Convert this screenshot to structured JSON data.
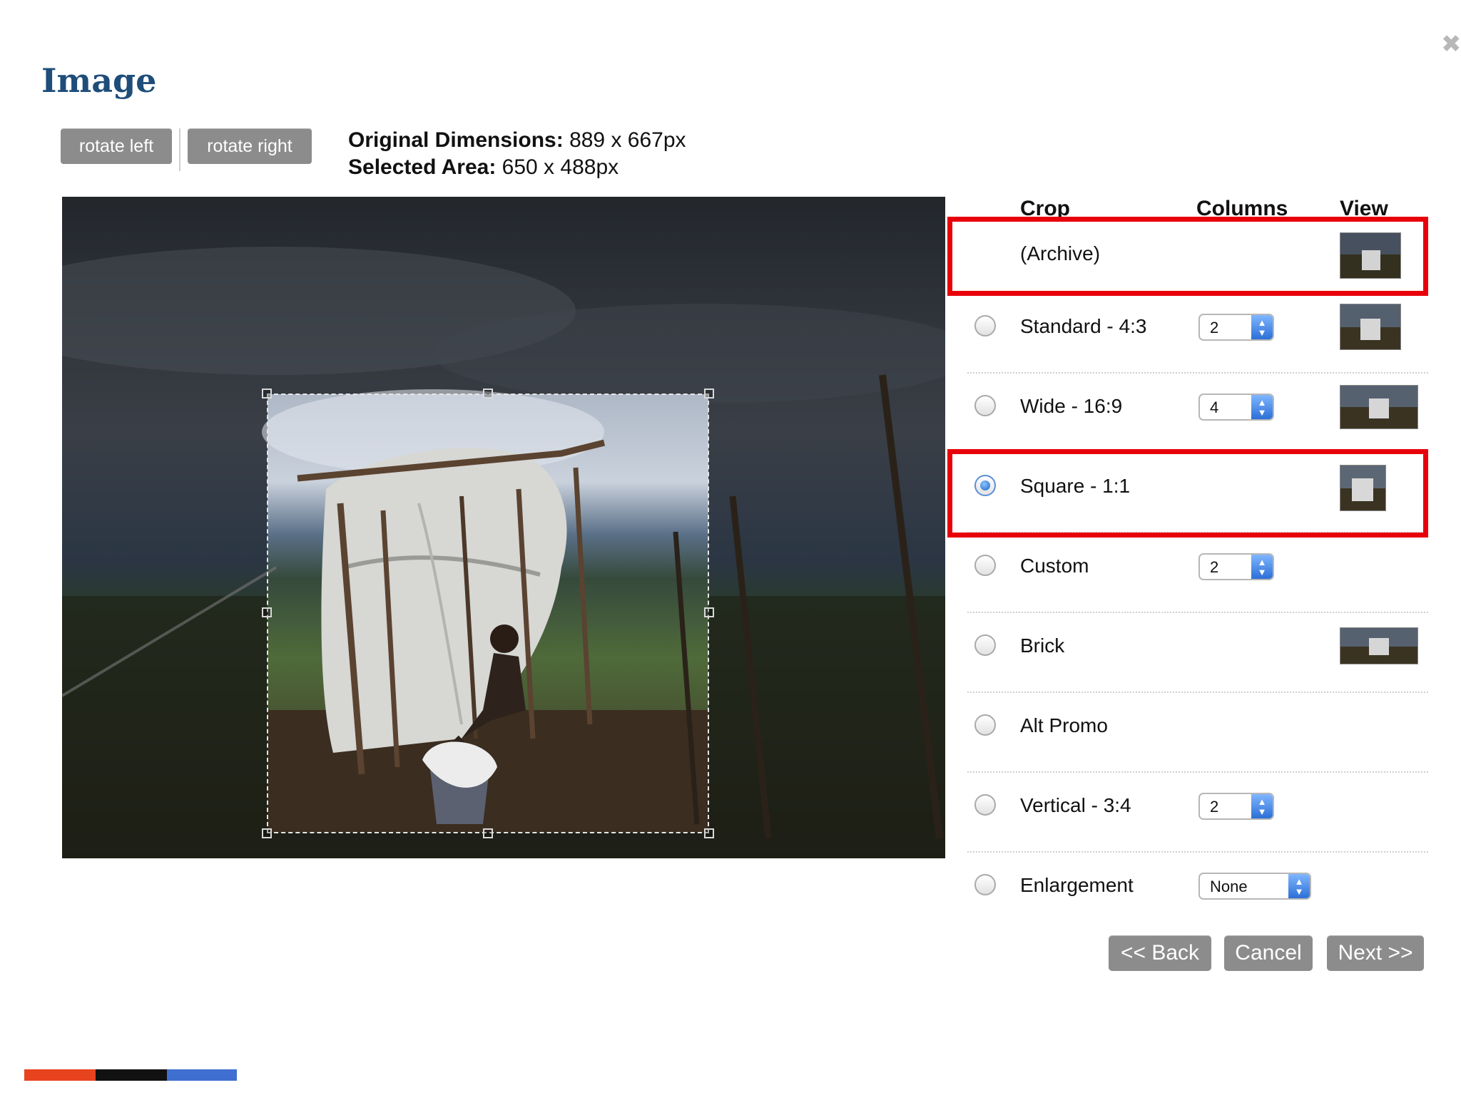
{
  "dialog": {
    "title": "Image",
    "close_symbol": "✖"
  },
  "toolbar": {
    "rotate_left": "rotate left",
    "rotate_right": "rotate right"
  },
  "dimensions": {
    "original_label": "Original Dimensions:",
    "original_value": "889 x 667px",
    "selected_label": "Selected Area:",
    "selected_value": "650 x 488px"
  },
  "table": {
    "headers": {
      "crop": "Crop",
      "columns": "Columns",
      "view": "View"
    }
  },
  "crop_options": [
    {
      "label": "(Archive)",
      "has_radio": false,
      "columns": null,
      "has_thumb": true,
      "highlighted": true
    },
    {
      "label": "Standard - 4:3",
      "has_radio": true,
      "selected": false,
      "columns": "2",
      "has_thumb": true
    },
    {
      "label": "Wide - 16:9",
      "has_radio": true,
      "selected": false,
      "columns": "4",
      "has_thumb": true
    },
    {
      "label": "Square - 1:1",
      "has_radio": true,
      "selected": true,
      "columns": null,
      "has_thumb": true,
      "highlighted": true
    },
    {
      "label": "Custom",
      "has_radio": true,
      "selected": false,
      "columns": "2",
      "has_thumb": false
    },
    {
      "label": "Brick",
      "has_radio": true,
      "selected": false,
      "columns": null,
      "has_thumb": true
    },
    {
      "label": "Alt Promo",
      "has_radio": true,
      "selected": false,
      "columns": null,
      "has_thumb": false
    },
    {
      "label": "Vertical - 3:4",
      "has_radio": true,
      "selected": false,
      "columns": "2",
      "has_thumb": false
    },
    {
      "label": "Enlargement",
      "has_radio": true,
      "selected": false,
      "columns": "None",
      "has_thumb": false
    }
  ],
  "nav": {
    "back": "<< Back",
    "cancel": "Cancel",
    "next": "Next >>"
  },
  "colors": {
    "title": "#1f4d7a",
    "button_gray": "#8c8c8c",
    "highlight_red": "#e8000b",
    "select_arrow_blue": "#2c6fd6"
  }
}
